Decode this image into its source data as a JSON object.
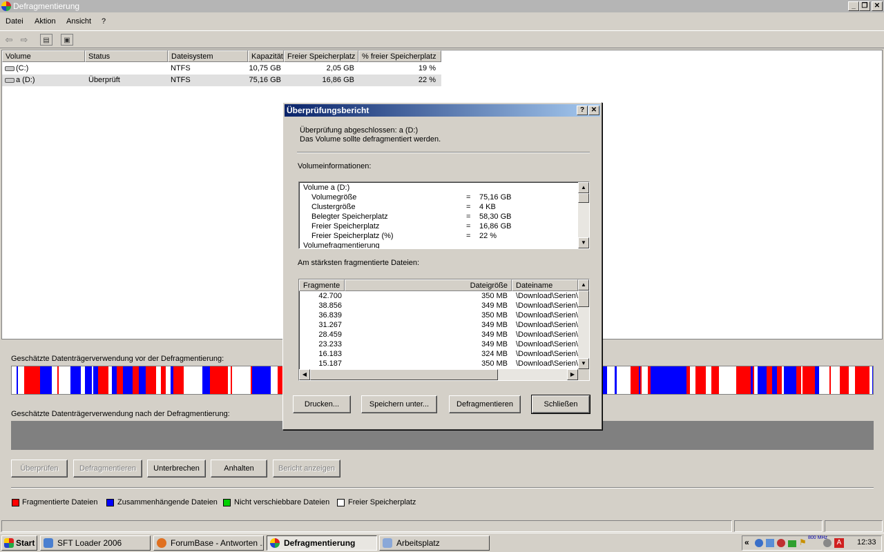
{
  "window": {
    "title": "Defragmentierung"
  },
  "menu": [
    "Datei",
    "Aktion",
    "Ansicht",
    "?"
  ],
  "columns": [
    "Volume",
    "Status",
    "Dateisystem",
    "Kapazität",
    "Freier Speicherplatz",
    "% freier Speicherplatz"
  ],
  "volumes": [
    {
      "name": "(C:)",
      "status": "",
      "fs": "NTFS",
      "capacity": "10,75 GB",
      "free": "2,05 GB",
      "pct": "19 %"
    },
    {
      "name": "a (D:)",
      "status": "Überprüft",
      "fs": "NTFS",
      "capacity": "75,16 GB",
      "free": "16,86 GB",
      "pct": "22 %"
    }
  ],
  "analysis": {
    "before_label": "Geschätzte Datenträgerverwendung vor der Defragmentierung:",
    "after_label": "Geschätzte Datenträgerverwendung nach der Defragmentierung:"
  },
  "buttons": {
    "analyze": "Überprüfen",
    "defrag": "Defragmentieren",
    "pause": "Unterbrechen",
    "stop": "Anhalten",
    "report": "Bericht anzeigen"
  },
  "legend": [
    {
      "label": "Fragmentierte Dateien",
      "color": "#ff0000"
    },
    {
      "label": "Zusammenhängende Dateien",
      "color": "#0000ff"
    },
    {
      "label": "Nicht verschiebbare Dateien",
      "color": "#00d000"
    },
    {
      "label": "Freier Speicherplatz",
      "color": "#ffffff"
    }
  ],
  "dialog": {
    "title": "Überprüfungsbericht",
    "line1": "Überprüfung abgeschlossen: a (D:)",
    "line2": "Das Volume sollte defragmentiert werden.",
    "vol_info_label": "Volumeinformationen:",
    "vol_info": {
      "header": "Volume  a (D:)",
      "rows": [
        {
          "k": "Volumegröße",
          "v": "75,16 GB"
        },
        {
          "k": "Clustergröße",
          "v": "4 KB"
        },
        {
          "k": "Belegter Speicherplatz",
          "v": "58,30 GB"
        },
        {
          "k": "Freier Speicherplatz",
          "v": "16,86 GB"
        },
        {
          "k": "Freier Speicherplatz (%)",
          "v": "22 %"
        }
      ],
      "footer": "Volumefragmentierung",
      "eq": "="
    },
    "files_label": "Am stärksten fragmentierte Dateien:",
    "file_cols": [
      "Fragmente",
      "Dateigröße",
      "Dateiname"
    ],
    "files": [
      {
        "frag": "42.700",
        "size": "350 MB",
        "name": "\\Download\\Serien\\"
      },
      {
        "frag": "38.856",
        "size": "349 MB",
        "name": "\\Download\\Serien\\"
      },
      {
        "frag": "36.839",
        "size": "350 MB",
        "name": "\\Download\\Serien\\"
      },
      {
        "frag": "31.267",
        "size": "349 MB",
        "name": "\\Download\\Serien\\"
      },
      {
        "frag": "28.459",
        "size": "349 MB",
        "name": "\\Download\\Serien\\"
      },
      {
        "frag": "23.233",
        "size": "349 MB",
        "name": "\\Download\\Serien\\"
      },
      {
        "frag": "16.183",
        "size": "324 MB",
        "name": "\\Download\\Serien\\"
      },
      {
        "frag": "15.187",
        "size": "350 MB",
        "name": "\\Download\\Serien\\"
      }
    ],
    "buttons": {
      "print": "Drucken...",
      "save": "Speichern unter...",
      "defrag": "Defragmentieren",
      "close": "Schließen"
    }
  },
  "taskbar": {
    "start": "Start",
    "tasks": [
      "SFT Loader 2006",
      "ForumBase - Antworten ...",
      "Defragmentierung",
      "Arbeitsplatz"
    ],
    "clock": "12:33",
    "cpu": "800 MHz"
  }
}
